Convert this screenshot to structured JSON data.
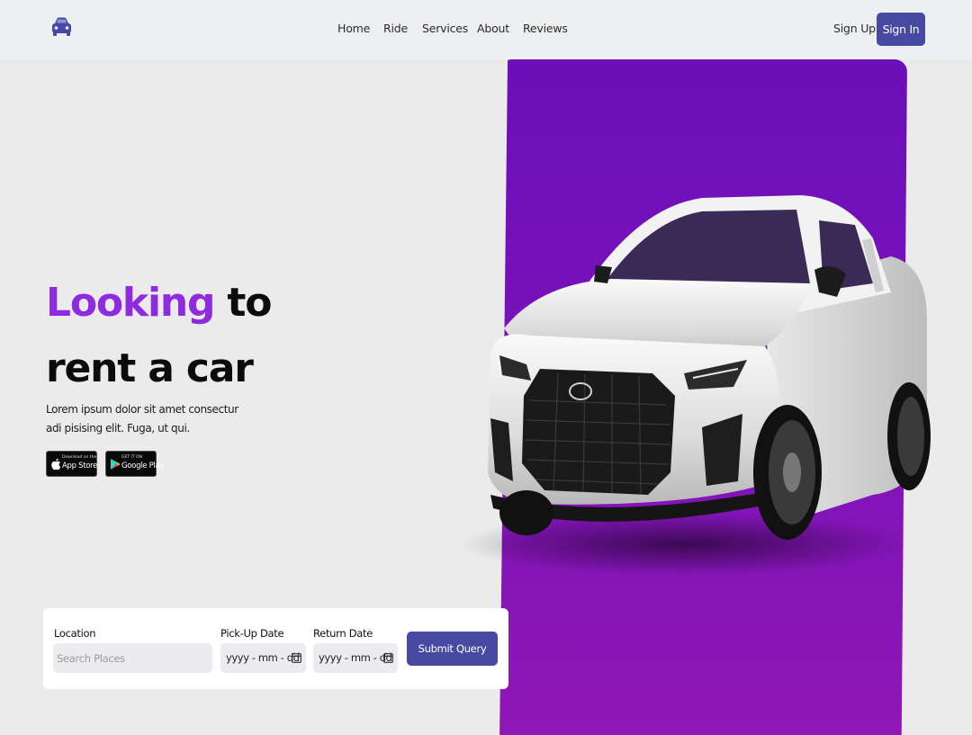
{
  "header": {
    "logo_icon": "car-icon",
    "nav": [
      "Home",
      "Ride",
      "Services",
      "About",
      "Reviews"
    ],
    "sign_up": "Sign Up",
    "sign_in": "Sign In"
  },
  "hero": {
    "title_accent": "Looking",
    "title_rest_line1": " to",
    "title_line2": "rent a car",
    "description": "Lorem ipsum dolor sit amet consectur adi pisising elit. Fuga, ut qui.",
    "app_store": {
      "small": "Download on the",
      "big": "App Store",
      "icon": "apple-icon"
    },
    "google_play": {
      "small": "GET IT ON",
      "big": "Google Play",
      "icon": "play-icon"
    }
  },
  "booking": {
    "location_label": "Location",
    "location_placeholder": "Search Places",
    "pickup_label": "Pick-Up Date",
    "pickup_value": "yyyy - mm - dd",
    "return_label": "Return Date",
    "return_value": "yyyy - mm - dd",
    "submit_label": "Submit Query",
    "calendar_icon": "calendar-icon"
  },
  "colors": {
    "accent": "#8e2be0",
    "button": "#474aa0",
    "panel_top": "#6b0fb9",
    "panel_bottom": "#9017b5",
    "background": "#ebebeb"
  }
}
